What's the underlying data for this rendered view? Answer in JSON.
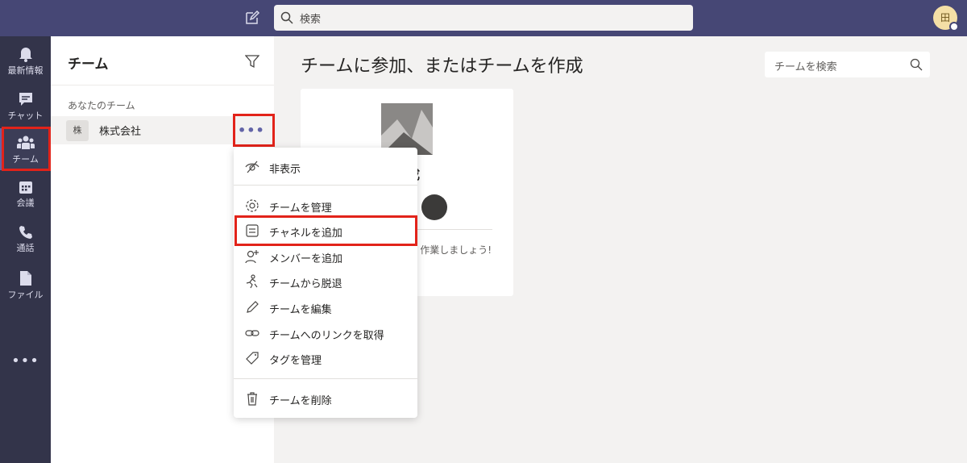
{
  "topbar": {
    "search_placeholder": "検索",
    "avatar_initial": "田"
  },
  "rail": {
    "items": [
      {
        "label": "最新情報",
        "icon": "bell-icon"
      },
      {
        "label": "チャット",
        "icon": "chat-icon"
      },
      {
        "label": "チーム",
        "icon": "teams-icon",
        "active": true
      },
      {
        "label": "会議",
        "icon": "calendar-icon"
      },
      {
        "label": "通話",
        "icon": "phone-icon"
      },
      {
        "label": "ファイル",
        "icon": "file-icon"
      }
    ],
    "more": "•••"
  },
  "panel": {
    "title": "チーム",
    "section": "あなたのチーム",
    "team": {
      "avatar": "株",
      "name": "株式会社",
      "more": "•••"
    }
  },
  "main": {
    "title": "チームに参加、またはチームを作成",
    "search_placeholder": "チームを検索",
    "card": {
      "title": "作成",
      "subtitle": "作業しましょう!"
    }
  },
  "menu": {
    "items": [
      {
        "label": "非表示",
        "icon": "hide-icon"
      },
      {
        "label": "チームを管理",
        "icon": "gear-icon"
      },
      {
        "label": "チャネルを追加",
        "icon": "channel-icon"
      },
      {
        "label": "メンバーを追加",
        "icon": "add-member-icon"
      },
      {
        "label": "チームから脱退",
        "icon": "leave-icon"
      },
      {
        "label": "チームを編集",
        "icon": "pencil-icon"
      },
      {
        "label": "チームへのリンクを取得",
        "icon": "link-icon"
      },
      {
        "label": "タグを管理",
        "icon": "tag-icon"
      },
      {
        "label": "チームを削除",
        "icon": "trash-icon"
      }
    ]
  },
  "colors": {
    "topbar": "#464775",
    "rail": "#33344a",
    "accent": "#6264a7",
    "highlight_box": "#e2231a"
  }
}
